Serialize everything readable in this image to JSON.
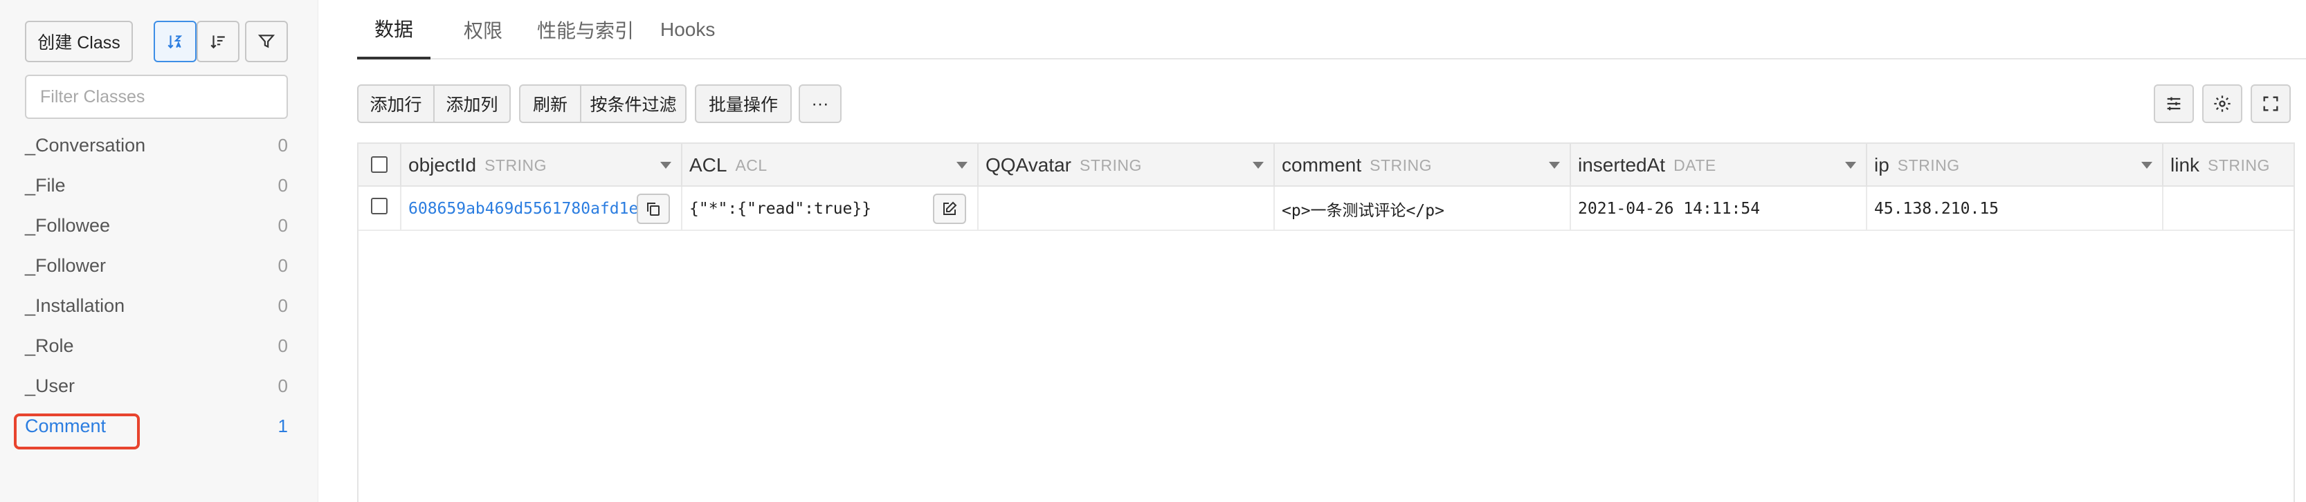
{
  "sidebar": {
    "create_class_label": "创建 Class",
    "filter_placeholder": "Filter Classes",
    "classes": [
      {
        "name": "_Conversation",
        "count": "0"
      },
      {
        "name": "_File",
        "count": "0"
      },
      {
        "name": "_Followee",
        "count": "0"
      },
      {
        "name": "_Follower",
        "count": "0"
      },
      {
        "name": "_Installation",
        "count": "0"
      },
      {
        "name": "_Role",
        "count": "0"
      },
      {
        "name": "_User",
        "count": "0"
      },
      {
        "name": "Comment",
        "count": "1"
      }
    ],
    "selected_class": "Comment"
  },
  "tabs": [
    {
      "label": "数据",
      "active": true
    },
    {
      "label": "权限",
      "active": false
    },
    {
      "label": "性能与索引",
      "active": false
    },
    {
      "label": "Hooks",
      "active": false
    }
  ],
  "toolbar": {
    "add_row": "添加行",
    "add_column": "添加列",
    "refresh": "刷新",
    "filter_by_condition": "按条件过滤",
    "batch_ops": "批量操作",
    "more": "···"
  },
  "table": {
    "columns": [
      {
        "name": "objectId",
        "type": "STRING"
      },
      {
        "name": "ACL",
        "type": "ACL"
      },
      {
        "name": "QQAvatar",
        "type": "STRING"
      },
      {
        "name": "comment",
        "type": "STRING"
      },
      {
        "name": "insertedAt",
        "type": "DATE"
      },
      {
        "name": "ip",
        "type": "STRING"
      },
      {
        "name": "link",
        "type": "STRING"
      }
    ],
    "rows": [
      {
        "objectId": "608659ab469d5561780afd1e",
        "ACL": "{\"*\":{\"read\":true}}",
        "QQAvatar": "",
        "comment": "<p>一条测试评论</p>",
        "insertedAt": "2021-04-26 14:11:54",
        "ip": "45.138.210.15",
        "link": ""
      }
    ]
  },
  "colors": {
    "accent": "#2b7de0",
    "highlight": "#e8442e"
  }
}
